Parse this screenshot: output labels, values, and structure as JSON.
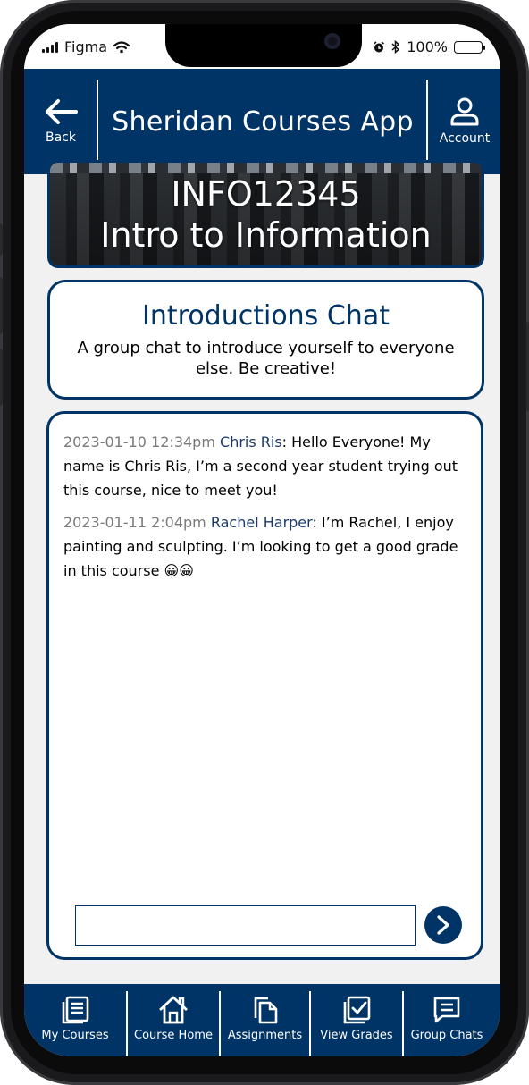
{
  "status_bar": {
    "carrier": "Figma",
    "battery": "100%",
    "icons": [
      "signal-icon",
      "wifi-icon",
      "alarm-icon",
      "bluetooth-icon",
      "battery-icon"
    ]
  },
  "header": {
    "back_label": "Back",
    "title": "Sheridan Courses App",
    "account_label": "Account"
  },
  "course": {
    "code": "INFO12345",
    "name": "Intro to Information"
  },
  "chat_info": {
    "title": "Introductions Chat",
    "description": "A group chat to introduce yourself to everyone else. Be creative!"
  },
  "messages": [
    {
      "timestamp": "2023-01-10 12:34pm",
      "author": "Chris Ris",
      "text": ": Hello Everyone! My name is Chris Ris, I’m a second year student trying out this course, nice to meet you!"
    },
    {
      "timestamp": "2023-01-11 2:04pm",
      "author": "Rachel Harper",
      "text": ": I’m Rachel, I enjoy painting and sculpting. I’m looking to get a good grade in this course 😀😀"
    }
  ],
  "composer": {
    "value": "",
    "placeholder": ""
  },
  "nav": {
    "items": [
      {
        "label": "My Courses",
        "icon": "courses-icon"
      },
      {
        "label": "Course Home",
        "icon": "home-icon"
      },
      {
        "label": "Assignments",
        "icon": "assignments-icon"
      },
      {
        "label": "View Grades",
        "icon": "grades-icon"
      },
      {
        "label": "Group Chats",
        "icon": "chat-icon"
      }
    ]
  },
  "colors": {
    "primary": "#003466",
    "background": "#f1f1f2",
    "timestamp": "#7a7a7a",
    "author": "#1b3a6b"
  }
}
